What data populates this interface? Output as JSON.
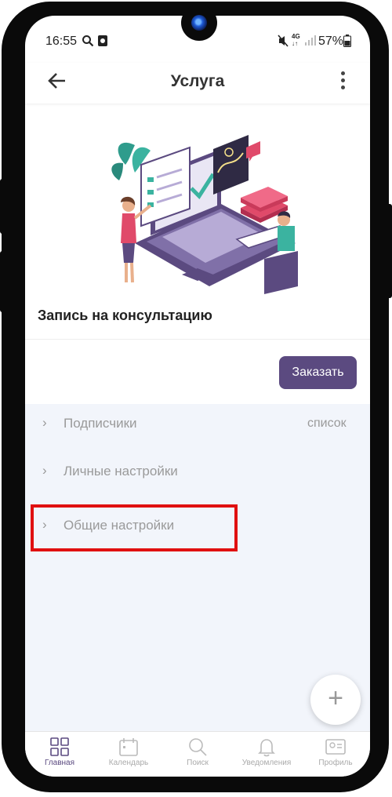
{
  "status_bar": {
    "time": "16:55",
    "battery": "57%"
  },
  "app_bar": {
    "title": "Услуга"
  },
  "service": {
    "name": "Запись на консультацию",
    "order_button": "Заказать"
  },
  "settings_list": [
    {
      "label": "Подписчики",
      "value": "список"
    },
    {
      "label": "Личные настройки",
      "value": ""
    },
    {
      "label": "Общие настройки",
      "value": ""
    }
  ],
  "fab": {
    "icon": "plus-icon"
  },
  "bottom_nav": [
    {
      "label": "Главная",
      "icon": "grid-icon",
      "active": true
    },
    {
      "label": "Календарь",
      "icon": "calendar-icon",
      "active": false
    },
    {
      "label": "Поиск",
      "icon": "search-icon",
      "active": false
    },
    {
      "label": "Уведомления",
      "icon": "bell-icon",
      "active": false
    },
    {
      "label": "Профиль",
      "icon": "profile-card-icon",
      "active": false
    }
  ],
  "colors": {
    "accent": "#5b4a80",
    "list_background": "#f2f5fb",
    "highlight": "#e01010"
  }
}
